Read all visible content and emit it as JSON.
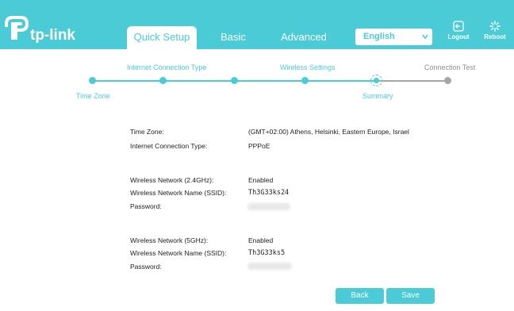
{
  "header": {
    "brand": "tp-link",
    "tabs": [
      {
        "label": "Quick Setup"
      },
      {
        "label": "Basic"
      },
      {
        "label": "Advanced"
      }
    ],
    "language": "English",
    "logout_label": "Logout",
    "reboot_label": "Reboot"
  },
  "progress": {
    "steps": [
      {
        "label": "Time Zone"
      },
      {
        "label": "Internet Connection Type"
      },
      {
        "label": ""
      },
      {
        "label": "Wireless Settings"
      },
      {
        "label": "Summary"
      },
      {
        "label": "Connection Test"
      }
    ],
    "current_step": "Summary"
  },
  "summary": {
    "time_zone_label": "Time Zone:",
    "time_zone_value": "(GMT+02:00) Athens, Helsinki, Eastern Europe, Israel",
    "conn_type_label": "Internet Connection Type:",
    "conn_type_value": "PPPoE",
    "w24_label": "Wireless Network (2.4GHz):",
    "w24_value": "Enabled",
    "ssid24_label": "Wireless Network Name (SSID):",
    "ssid24_value": "Th3G33ks24",
    "pass24_label": "Password:",
    "w5_label": "Wireless Network (5GHz):",
    "w5_value": "Enabled",
    "ssid5_label": "Wireless Network Name (SSID):",
    "ssid5_value": "Th3G33ks5",
    "pass5_label": "Password:"
  },
  "buttons": {
    "back": "Back",
    "save": "Save"
  },
  "colors": {
    "accent": "#4acbd6",
    "inactive": "#a6a6a6"
  }
}
